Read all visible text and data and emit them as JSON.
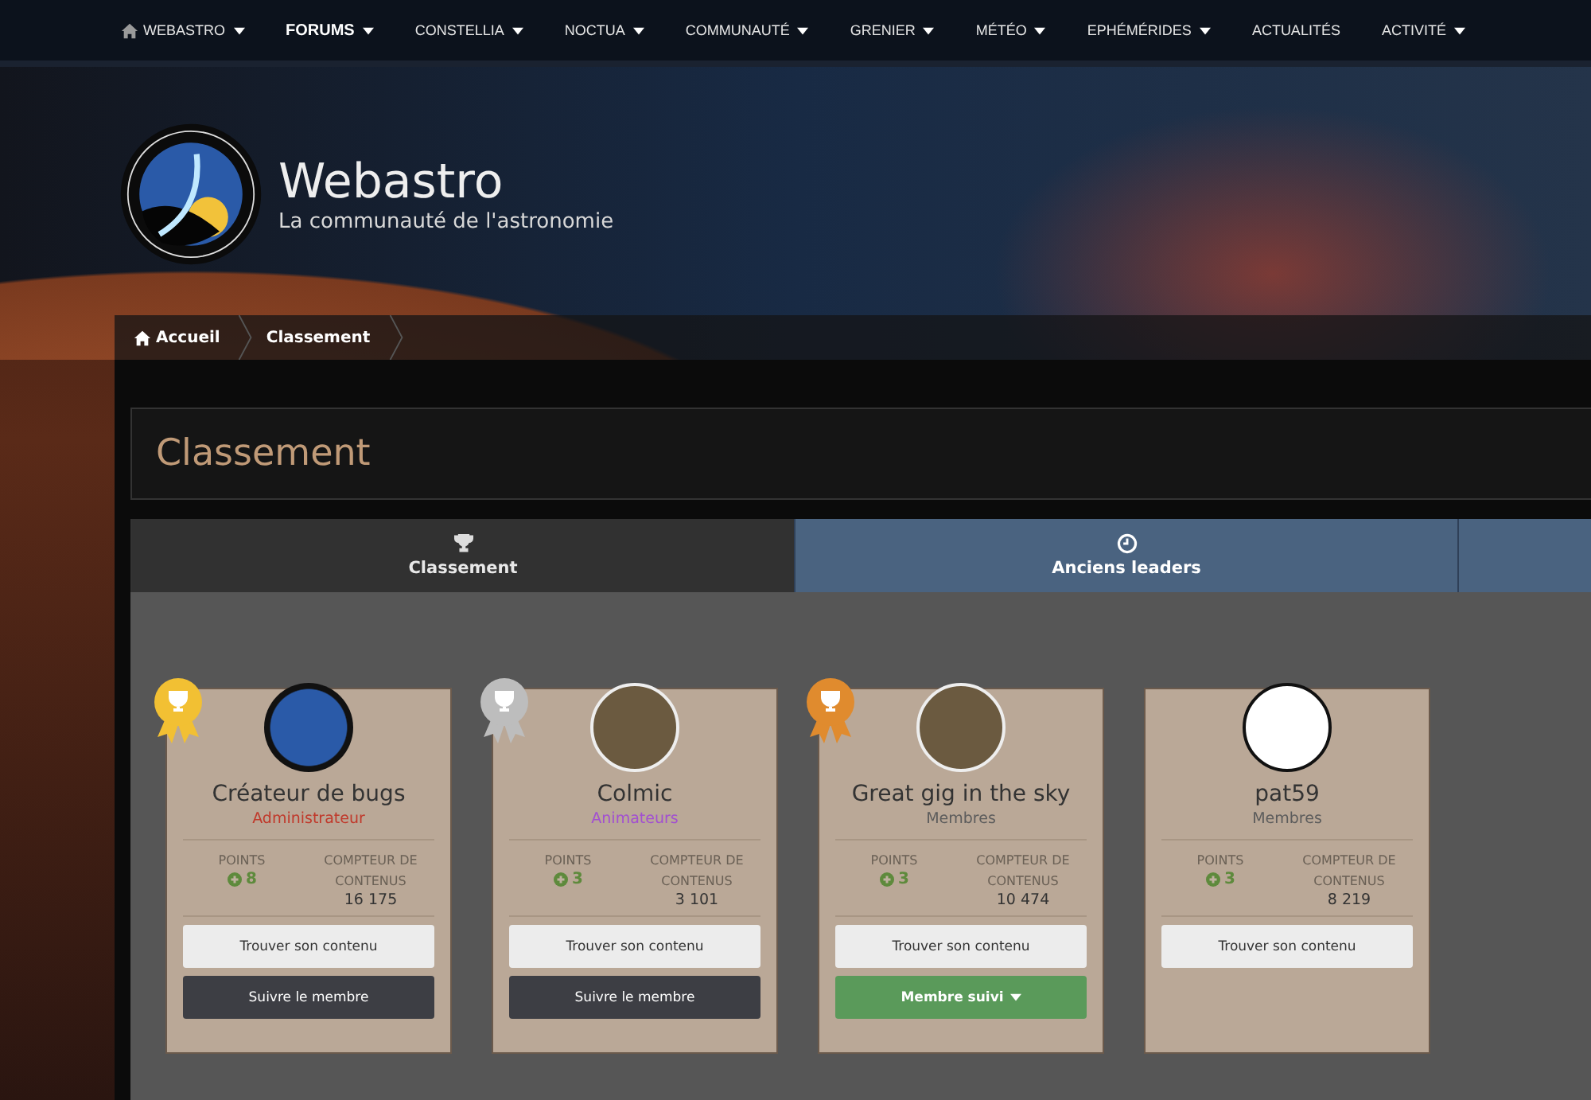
{
  "nav": [
    {
      "label": "WEBASTRO",
      "caret": true,
      "home_icon": true,
      "selected": false
    },
    {
      "label": "FORUMS",
      "caret": true,
      "home_icon": false,
      "selected": true
    },
    {
      "label": "CONSTELLIA",
      "caret": true,
      "home_icon": false,
      "selected": false
    },
    {
      "label": "NOCTUA",
      "caret": true,
      "home_icon": false,
      "selected": false
    },
    {
      "label": "COMMUNAUTÉ",
      "caret": true,
      "home_icon": false,
      "selected": false
    },
    {
      "label": "GRENIER",
      "caret": true,
      "home_icon": false,
      "selected": false
    },
    {
      "label": "MÉTÉO",
      "caret": true,
      "home_icon": false,
      "selected": false
    },
    {
      "label": "EPHÉMÉRIDES",
      "caret": true,
      "home_icon": false,
      "selected": false
    },
    {
      "label": "ACTUALITÉS",
      "caret": false,
      "home_icon": false,
      "selected": false
    },
    {
      "label": "ACTIVITÉ",
      "caret": true,
      "home_icon": false,
      "selected": false
    }
  ],
  "site": {
    "title": "Webastro",
    "tagline": "La communauté de l'astronomie"
  },
  "breadcrumb": [
    {
      "label": "Accueil",
      "home_icon": true
    },
    {
      "label": "Classement",
      "home_icon": false
    }
  ],
  "page_title": "Classement",
  "tabs": [
    {
      "label": "Classement",
      "selected": true
    },
    {
      "label": "Anciens leaders",
      "selected": false
    }
  ],
  "members": [
    {
      "name": "Créateur de bugs",
      "role": {
        "label": "Administrateur",
        "color": "#c0392b"
      },
      "medal": {
        "color": "#f2c033"
      },
      "points_label": "POINTS",
      "points": "8",
      "content_label": "COMPTEUR DE CONTENUS",
      "content_count": "16 175",
      "find_button": "Trouver son contenu",
      "follow": {
        "kind": "follow",
        "label": "Suivre le membre"
      }
    },
    {
      "name": "Colmic",
      "role": {
        "label": "Animateurs",
        "color": "#a24fd1"
      },
      "medal": {
        "color": "#bdbdbd"
      },
      "points_label": "POINTS",
      "points": "3",
      "content_label": "COMPTEUR DE CONTENUS",
      "content_count": "3 101",
      "find_button": "Trouver son contenu",
      "follow": {
        "kind": "follow",
        "label": "Suivre le membre"
      }
    },
    {
      "name": "Great gig in the sky",
      "role": {
        "label": "Membres",
        "color": "#5c5c5c"
      },
      "medal": {
        "color": "#e08b2e"
      },
      "points_label": "POINTS",
      "points": "3",
      "content_label": "COMPTEUR DE CONTENUS",
      "content_count": "10 474",
      "find_button": "Trouver son contenu",
      "follow": {
        "kind": "following",
        "label": "Membre suivi"
      }
    },
    {
      "name": "pat59",
      "role": {
        "label": "Membres",
        "color": "#5c5c5c"
      },
      "points_label": "POINTS",
      "points": "3",
      "content_label": "COMPTEUR DE CONTENUS",
      "content_count": "8 219",
      "find_button": "Trouver son contenu"
    }
  ]
}
